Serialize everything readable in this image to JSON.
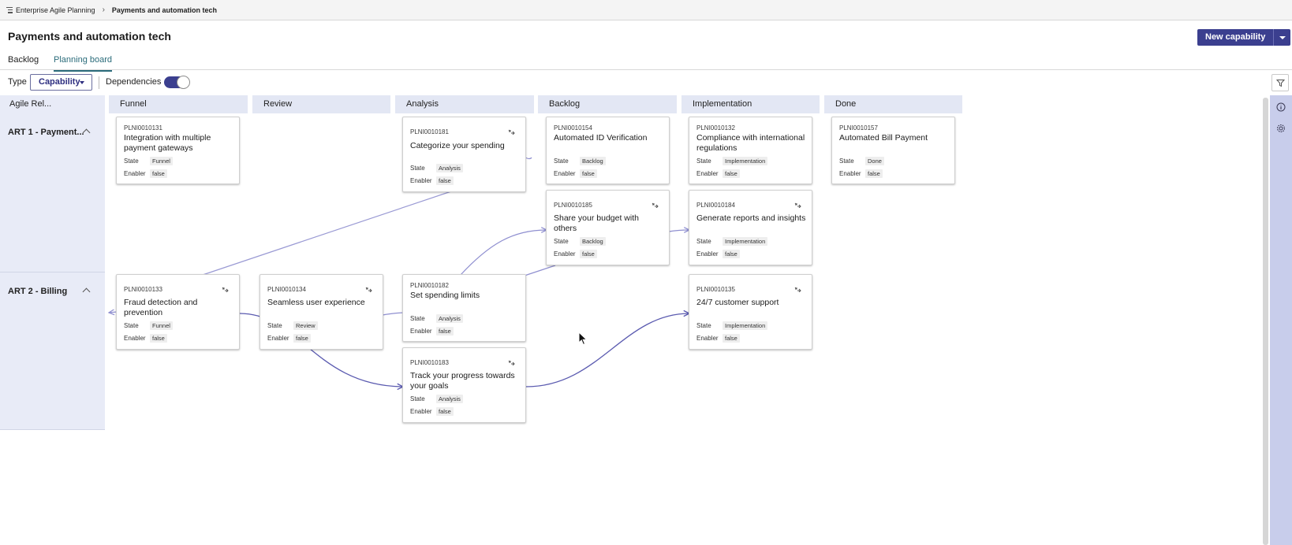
{
  "breadcrumb": {
    "root": "Enterprise Agile Planning",
    "current": "Payments and automation tech"
  },
  "page": {
    "title": "Payments and automation tech",
    "new_button": "New capability"
  },
  "tabs": [
    {
      "label": "Backlog"
    },
    {
      "label": "Planning board",
      "active": true
    }
  ],
  "filters": {
    "type_label": "Type",
    "type_value": "Capability",
    "dependencies_label": "Dependencies",
    "dependencies_on": true
  },
  "board": {
    "row_header_title": "Agile Rel...",
    "columns": [
      "Funnel",
      "Review",
      "Analysis",
      "Backlog",
      "Implementation",
      "Done"
    ],
    "rows": [
      "ART 1 - Payment...",
      "ART 2 - Billing"
    ],
    "field_labels": {
      "state": "State",
      "enabler": "Enabler"
    }
  },
  "cards": [
    {
      "id": "PLNI0010131",
      "title": "Integration with multiple payment gateways",
      "state": "Funnel",
      "enabler": "false",
      "linked": false
    },
    {
      "id": "PLNI0010181",
      "title": "Categorize your spending",
      "state": "Analysis",
      "enabler": "false",
      "linked": true
    },
    {
      "id": "PLNI0010154",
      "title": "Automated ID Verification",
      "state": "Backlog",
      "enabler": "false",
      "linked": false
    },
    {
      "id": "PLNI0010132",
      "title": "Compliance with international regulations",
      "state": "Implementation",
      "enabler": "false",
      "linked": false
    },
    {
      "id": "PLNI0010157",
      "title": "Automated Bill Payment",
      "state": "Done",
      "enabler": "false",
      "linked": false
    },
    {
      "id": "PLNI0010185",
      "title": "Share your budget with others",
      "state": "Backlog",
      "enabler": "false",
      "linked": true
    },
    {
      "id": "PLNI0010184",
      "title": "Generate reports and insights",
      "state": "Implementation",
      "enabler": "false",
      "linked": true
    },
    {
      "id": "PLNI0010133",
      "title": "Fraud detection and prevention",
      "state": "Funnel",
      "enabler": "false",
      "linked": true
    },
    {
      "id": "PLNI0010134",
      "title": "Seamless user experience",
      "state": "Review",
      "enabler": "false",
      "linked": true
    },
    {
      "id": "PLNI0010182",
      "title": "Set spending limits",
      "state": "Analysis",
      "enabler": "false",
      "linked": false
    },
    {
      "id": "PLNI0010135",
      "title": "24/7 customer support",
      "state": "Implementation",
      "enabler": "false",
      "linked": true
    },
    {
      "id": "PLNI0010183",
      "title": "Track your progress towards your goals",
      "state": "Analysis",
      "enabler": "false",
      "linked": true
    }
  ],
  "colors": {
    "accent": "#3b3f8f",
    "tab_active": "#2a6b7a",
    "dependency_line": "#8f8fd0",
    "dependency_line_strong": "#5b5bb0"
  }
}
